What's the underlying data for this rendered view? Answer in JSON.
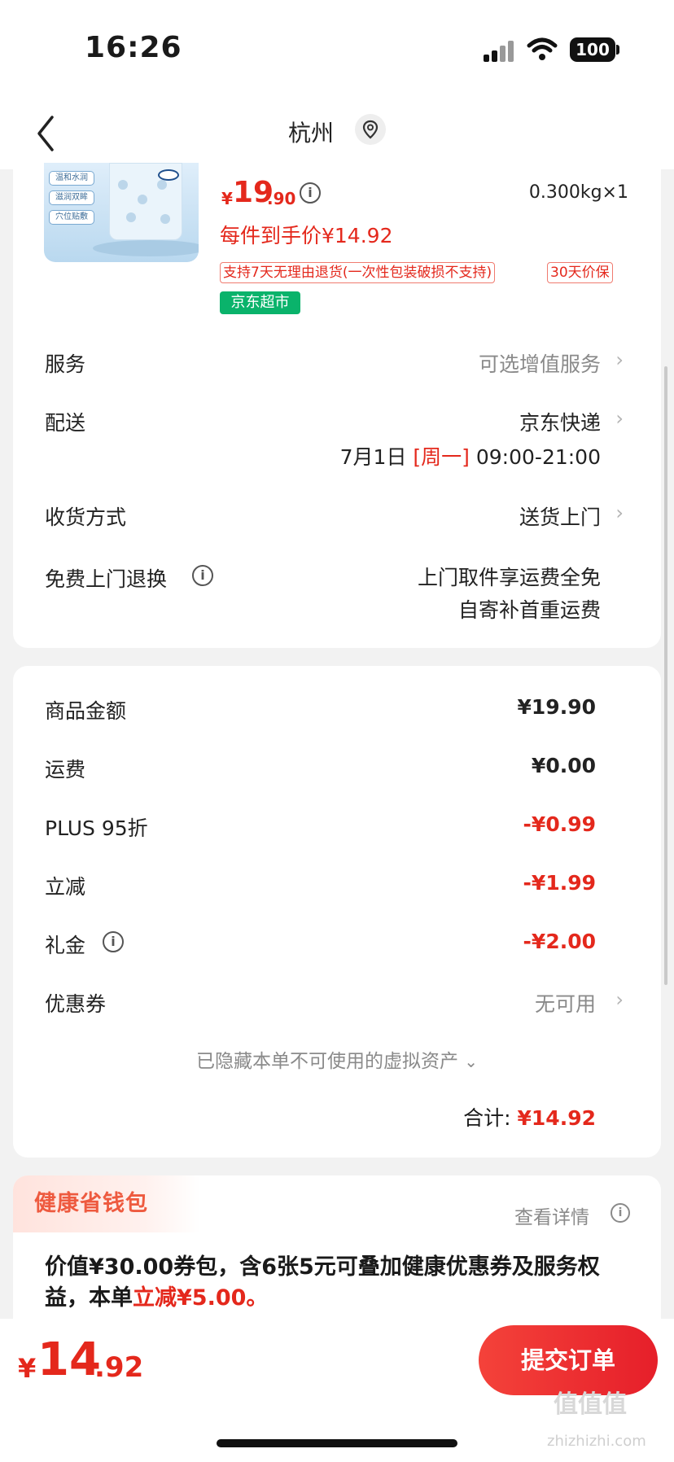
{
  "status_bar": {
    "time": "16:26",
    "battery": "100"
  },
  "nav": {
    "city": "杭州"
  },
  "product": {
    "image_tags": [
      "温和水润",
      "滋润双眸",
      "穴位贴敷"
    ],
    "price_symbol": "¥",
    "price_int": "19",
    "price_dec": ".90",
    "weight_qty": "0.300kg×1",
    "hand_price": "每件到手价¥14.92",
    "return_policy": "支持7天无理由退货(一次性包装破损不支持)",
    "price_protect": "30天价保",
    "store_badge": "京东超市"
  },
  "service": {
    "label": "服务",
    "value": "可选增值服务"
  },
  "delivery": {
    "label": "配送",
    "value": "京东快递",
    "date": "7月1日",
    "weekday": "[周一]",
    "window": "09:00-21:00"
  },
  "receive": {
    "label": "收货方式",
    "value": "送货上门"
  },
  "free_return": {
    "label": "免费上门退换",
    "line1": "上门取件享运费全免",
    "line2": "自寄补首重运费"
  },
  "summary": {
    "rows": [
      {
        "label": "商品金额",
        "value": "¥19.90"
      },
      {
        "label": "运费",
        "value": "¥0.00"
      },
      {
        "label": "PLUS 95折",
        "value": "-¥0.99"
      },
      {
        "label": "立减",
        "value": "-¥1.99"
      },
      {
        "label": "礼金",
        "value": "-¥2.00"
      }
    ],
    "coupon_label": "优惠券",
    "coupon_value": "无可用",
    "hidden_note": "已隐藏本单不可使用的虚拟资产",
    "total_label": "合计:",
    "total_value": "¥14.92"
  },
  "wallet": {
    "title": "健康省钱包",
    "detail": "查看详情",
    "desc_prefix": "价值¥30.00券包，含6张5元可叠加健康优惠券及服务权益，本单",
    "desc_highlight": "立减¥5.00。"
  },
  "bottom": {
    "symbol": "¥",
    "int": "14",
    "dec": ".92",
    "submit": "提交订单"
  },
  "watermark": {
    "text": "值值值",
    "sub": "zhizhizhi.com"
  },
  "colors": {
    "accent_red": "#e4281c",
    "badge_green": "#0ab36b",
    "wallet_orange": "#ee5a3f"
  }
}
